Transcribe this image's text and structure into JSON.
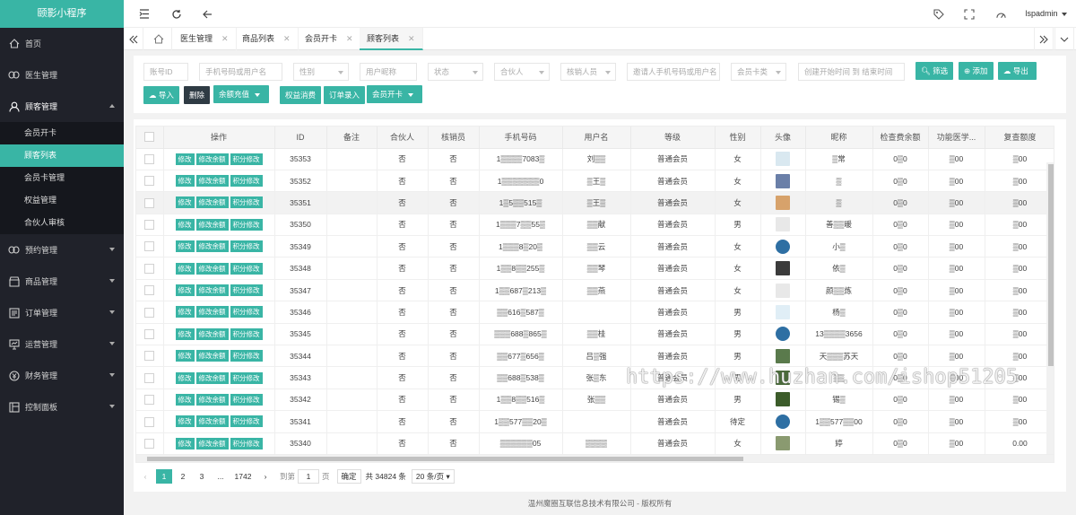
{
  "app": {
    "title": "颐影小程序"
  },
  "sidebar": {
    "items": [
      {
        "label": "首页",
        "icon": "home-icon"
      },
      {
        "label": "医生管理",
        "icon": "link-icon"
      },
      {
        "label": "顾客管理",
        "icon": "user-icon",
        "sub": [
          "会员开卡",
          "顾客列表",
          "会员卡管理",
          "权益管理",
          "合伙人审核"
        ],
        "active_sub": "顾客列表"
      },
      {
        "label": "预约管理",
        "icon": "link-icon"
      },
      {
        "label": "商品管理",
        "icon": "shop-icon"
      },
      {
        "label": "订单管理",
        "icon": "list-icon"
      },
      {
        "label": "运营管理",
        "icon": "monitor-icon"
      },
      {
        "label": "财务管理",
        "icon": "money-icon"
      },
      {
        "label": "控制面板",
        "icon": "panel-icon"
      }
    ]
  },
  "header": {
    "user": "lspadmin"
  },
  "tabs": [
    {
      "label": "医生管理"
    },
    {
      "label": "商品列表"
    },
    {
      "label": "会员开卡"
    },
    {
      "label": "顾客列表",
      "active": true
    }
  ],
  "filters": {
    "account_id": "账号ID",
    "phone_or_name": "手机号码或用户名",
    "gender": "性别",
    "nickname": "用户昵称",
    "status": "状态",
    "partner": "合伙人",
    "writeoff": "核销人员",
    "inviter": "邀请人手机号码或用户名",
    "card_type": "会员卡类",
    "date_range": "创建开始时间 到 结束时间",
    "filter_btn": "筛选",
    "add_btn": "添加",
    "export_btn": "导出",
    "import_btn": "导入",
    "delete_btn": "删除",
    "recharge_btn": "余额充值",
    "rights_btn": "权益消费",
    "order_btn": "订单录入",
    "open_card_btn": "会员开卡"
  },
  "table": {
    "headers": [
      "操作",
      "ID",
      "备注",
      "合伙人",
      "核销员",
      "手机号码",
      "用户名",
      "等级",
      "性别",
      "头像",
      "昵称",
      "检查费余额",
      "功能医学...",
      "复查额度"
    ],
    "action_labels": [
      "修改",
      "修改余额",
      "积分修改"
    ],
    "rows": [
      {
        "id": "35353",
        "partner": "否",
        "writeoff": "否",
        "phone": "1▒▒▒▒7083▒",
        "name": "刘▒▒",
        "level": "普通会员",
        "gender": "女",
        "nick": "▒常",
        "bal": "0▒0",
        "func": "▒00",
        "rev": "▒00",
        "av": "#d9e8f0"
      },
      {
        "id": "35352",
        "partner": "否",
        "writeoff": "否",
        "phone": "1▒▒▒▒▒▒▒0",
        "name": "▒王▒",
        "level": "普通会员",
        "gender": "女",
        "nick": "▒",
        "bal": "0▒0",
        "func": "▒00",
        "rev": "▒00",
        "av": "#6a7fa8"
      },
      {
        "id": "35351",
        "partner": "否",
        "writeoff": "否",
        "phone": "1▒5▒▒515▒",
        "name": "▒王▒",
        "level": "普通会员",
        "gender": "女",
        "nick": "▒",
        "bal": "0▒0",
        "func": "▒00",
        "rev": "▒00",
        "av": "#d7a26b"
      },
      {
        "id": "35350",
        "partner": "否",
        "writeoff": "否",
        "phone": "1▒▒▒7▒▒55▒",
        "name": "▒▒献",
        "level": "普通会员",
        "gender": "男",
        "nick": "善▒▒暖",
        "bal": "0▒0",
        "func": "▒00",
        "rev": "▒00",
        "av": "#e8e8e8"
      },
      {
        "id": "35349",
        "partner": "否",
        "writeoff": "否",
        "phone": "1▒▒▒8▒20▒",
        "name": "▒▒云",
        "level": "普通会员",
        "gender": "女",
        "nick": "小▒",
        "bal": "0▒0",
        "func": "▒00",
        "rev": "▒00",
        "av": "#2e6fa3",
        "round": true
      },
      {
        "id": "35348",
        "partner": "否",
        "writeoff": "否",
        "phone": "1▒▒8▒▒255▒",
        "name": "▒▒琴",
        "level": "普通会员",
        "gender": "女",
        "nick": "依▒",
        "bal": "0▒0",
        "func": "▒00",
        "rev": "▒00",
        "av": "#3b3b3b"
      },
      {
        "id": "35347",
        "partner": "否",
        "writeoff": "否",
        "phone": "1▒▒687▒213▒",
        "name": "▒▒燕",
        "level": "普通会员",
        "gender": "女",
        "nick": "颜▒▒炼",
        "bal": "0▒0",
        "func": "▒00",
        "rev": "▒00",
        "av": "#e8e8e8"
      },
      {
        "id": "35346",
        "partner": "否",
        "writeoff": "否",
        "phone": "▒▒616▒587▒",
        "name": "",
        "level": "普通会员",
        "gender": "男",
        "nick": "杨▒",
        "bal": "0▒0",
        "func": "▒00",
        "rev": "▒00",
        "av": "#e0eef6"
      },
      {
        "id": "35345",
        "partner": "否",
        "writeoff": "否",
        "phone": "▒▒▒688▒865▒",
        "name": "▒▒桂",
        "level": "普通会员",
        "gender": "男",
        "nick": "13▒▒▒▒3656",
        "bal": "0▒0",
        "func": "▒00",
        "rev": "▒00",
        "av": "#2e6fa3",
        "round": true
      },
      {
        "id": "35344",
        "partner": "否",
        "writeoff": "否",
        "phone": "▒▒677▒656▒",
        "name": "吕▒强",
        "level": "普通会员",
        "gender": "男",
        "nick": "天▒▒▒苏天",
        "bal": "0▒0",
        "func": "▒00",
        "rev": "▒00",
        "av": "#5a7a4c"
      },
      {
        "id": "35343",
        "partner": "否",
        "writeoff": "否",
        "phone": "▒▒688▒538▒",
        "name": "张▒东",
        "level": "普通会员",
        "gender": "男",
        "nick": "▒▒",
        "bal": "0▒0",
        "func": "▒00",
        "rev": "▒00",
        "av": "#4a6a3a"
      },
      {
        "id": "35342",
        "partner": "否",
        "writeoff": "否",
        "phone": "1▒▒8▒▒516▒",
        "name": "张▒▒",
        "level": "普通会员",
        "gender": "男",
        "nick": "锡▒",
        "bal": "0▒0",
        "func": "▒00",
        "rev": "▒00",
        "av": "#3c5c2a"
      },
      {
        "id": "35341",
        "partner": "否",
        "writeoff": "否",
        "phone": "1▒▒577▒▒20▒",
        "name": "",
        "level": "普通会员",
        "gender": "待定",
        "nick": "1▒▒577▒▒00",
        "bal": "0▒0",
        "func": "▒00",
        "rev": "▒00",
        "av": "#2e6fa3",
        "round": true
      },
      {
        "id": "35340",
        "partner": "否",
        "writeoff": "否",
        "phone": "▒▒▒▒▒▒05",
        "name": "▒▒▒▒",
        "level": "普通会员",
        "gender": "女",
        "nick": "婷",
        "bal": "0▒0",
        "func": "▒00",
        "rev": "0.00",
        "av": "#8a9a70"
      }
    ]
  },
  "pager": {
    "pages": [
      "1",
      "2",
      "3",
      "...",
      "1742"
    ],
    "goto_label": "到第",
    "goto_value": "1",
    "page_unit": "页",
    "confirm": "确定",
    "total": "共 34824 条",
    "per_page": "20 条/页"
  },
  "footer": "温州魔圈互联信息技术有限公司 - 版权所有",
  "watermark": "https://www.huzhan.com/ishop51205",
  "colors": {
    "accent": "#39b5a5",
    "sidebar": "#20222a"
  }
}
